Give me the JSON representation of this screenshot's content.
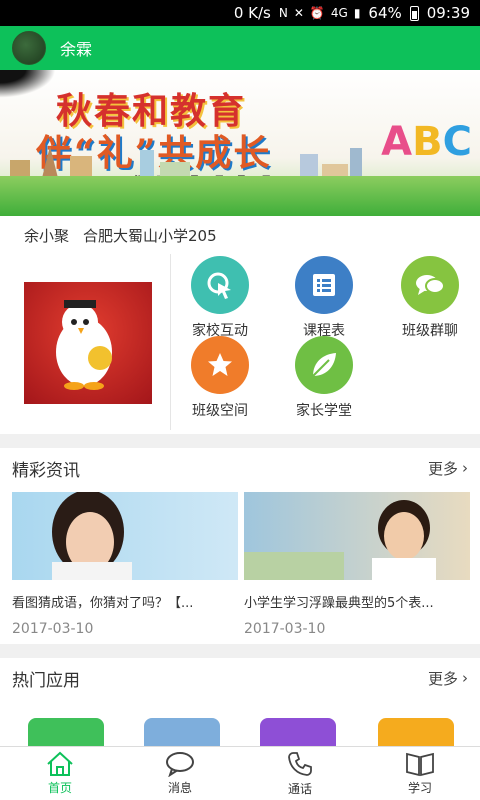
{
  "status_bar": {
    "network_speed": "0 K/s",
    "battery": "64%",
    "time": "09:39"
  },
  "header": {
    "user_name": "余霖"
  },
  "banner": {
    "line1": "秋春和教育",
    "line2": "伴“礼”共成长",
    "date_text": "活动时间:2月25日-4月30日",
    "letters": [
      "A",
      "B",
      "C"
    ]
  },
  "school": {
    "student": "余小聚",
    "school_name": "合肥大蜀山小学205"
  },
  "apps": [
    {
      "label": "家校互动",
      "icon": "touch-icon",
      "color": "#3fbfb0"
    },
    {
      "label": "课程表",
      "icon": "list-icon",
      "color": "#3d7fc6"
    },
    {
      "label": "班级群聊",
      "icon": "chat-icon",
      "color": "#86c440"
    },
    {
      "label": "班级空间",
      "icon": "star-icon",
      "color": "#f07c2a"
    },
    {
      "label": "家长学堂",
      "icon": "leaf-icon",
      "color": "#6fbf44"
    }
  ],
  "news_section": {
    "title": "精彩资讯",
    "more": "更多"
  },
  "news": [
    {
      "title": "看图猜成语，你猜对了吗？【...",
      "date": "2017-03-10"
    },
    {
      "title": "小学生学习浮躁最典型的5个表...",
      "date": "2017-03-10"
    }
  ],
  "hot_section": {
    "title": "热门应用",
    "more": "更多"
  },
  "tabs": [
    {
      "label": "首页",
      "icon": "home-icon",
      "active": true
    },
    {
      "label": "消息",
      "icon": "message-icon",
      "active": false
    },
    {
      "label": "通话",
      "icon": "phone-icon",
      "active": false
    },
    {
      "label": "学习",
      "icon": "book-icon",
      "active": false
    }
  ],
  "colors": {
    "brand": "#0dc15a"
  }
}
